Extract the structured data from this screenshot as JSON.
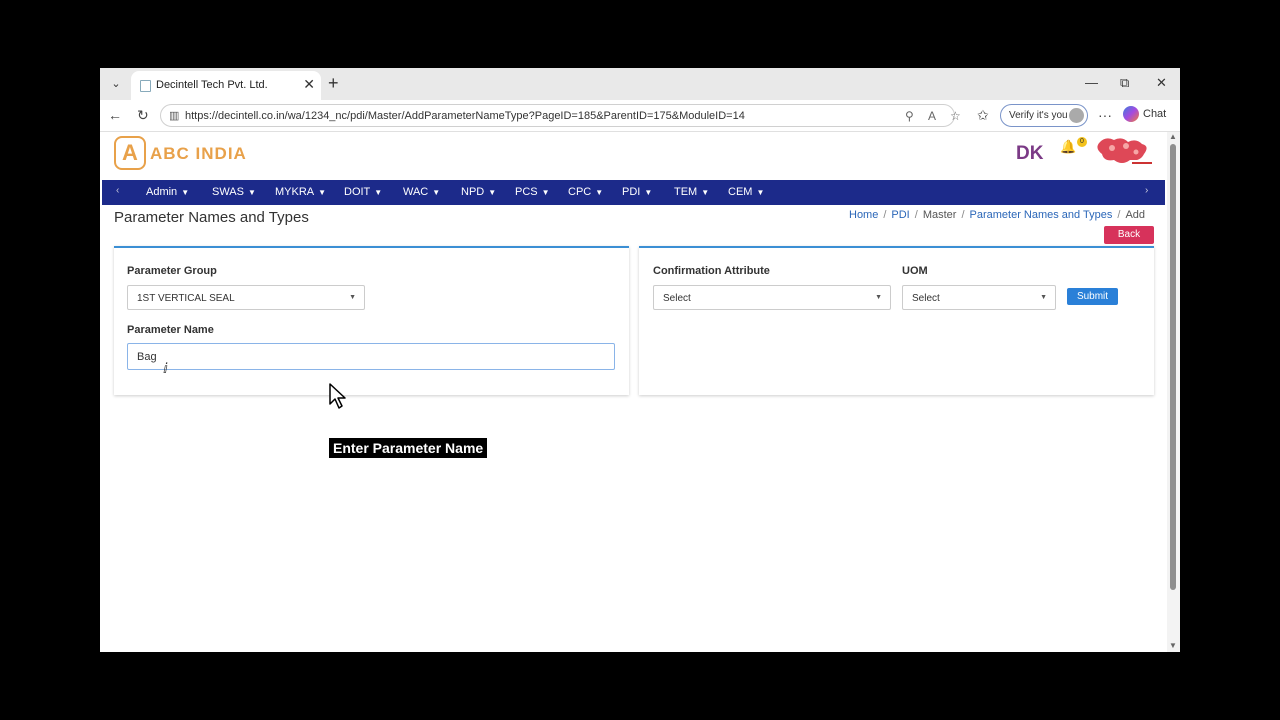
{
  "browser": {
    "tab_title": "Decintell Tech Pvt. Ltd.",
    "url": "https://decintell.co.in/wa/1234_nc/pdi/Master/AddParameterNameType?PageID=185&ParentID=175&ModuleID=14",
    "verify_label": "Verify it's you",
    "chat_label": "Chat"
  },
  "header": {
    "logo_letter": "A",
    "logo_text": "ABC INDIA",
    "user_initials": "DK",
    "notification_count": "0"
  },
  "nav": {
    "items": [
      "Admin",
      "SWAS",
      "MYKRA",
      "DOIT",
      "WAC",
      "NPD",
      "PCS",
      "CPC",
      "PDI",
      "TEM",
      "CEM"
    ]
  },
  "page": {
    "title": "Parameter Names and Types",
    "breadcrumb": [
      "Home",
      "PDI",
      "Master",
      "Parameter Names and Types",
      "Add"
    ],
    "back_label": "Back"
  },
  "form": {
    "parameter_group_label": "Parameter Group",
    "parameter_group_value": "1ST VERTICAL SEAL",
    "parameter_name_label": "Parameter Name",
    "parameter_name_value": "Bag",
    "confirmation_attribute_label": "Confirmation Attribute",
    "confirmation_attribute_value": "Select",
    "uom_label": "UOM",
    "uom_value": "Select",
    "submit_label": "Submit"
  },
  "caption": "Enter Parameter Name",
  "colors": {
    "nav_bg": "#1c2a8a",
    "accent": "#3b8fd4",
    "back_btn": "#d7325b",
    "submit_btn": "#2a80d8",
    "logo": "#e8a14a"
  }
}
